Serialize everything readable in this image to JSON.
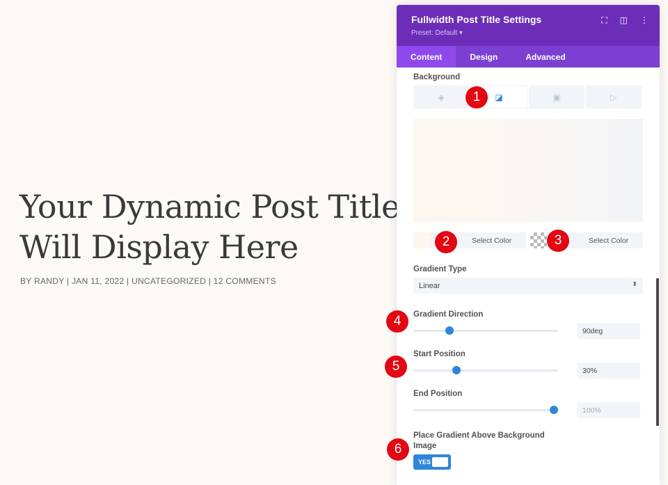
{
  "page": {
    "title": "Your Dynamic Post Title Will Display Here",
    "meta": "BY RANDY | JAN 11, 2022 | UNCATEGORIZED | 12 COMMENTS"
  },
  "panel": {
    "title": "Fullwidth Post Title Settings",
    "preset": "Preset: Default ▾",
    "tabs": [
      "Content",
      "Design",
      "Advanced"
    ],
    "background_label": "Background",
    "bg_tabs": [
      "color-icon",
      "gradient-icon",
      "image-icon",
      "video-icon"
    ],
    "color1": {
      "label": "Select Color",
      "swatch": "#fdf7f1"
    },
    "color2": {
      "label": "Select Color",
      "swatch": "transparent"
    },
    "gradient_type": {
      "label": "Gradient Type",
      "value": "Linear"
    },
    "gradient_direction": {
      "label": "Gradient Direction",
      "value": "90deg",
      "fraction": 0.25
    },
    "start_position": {
      "label": "Start Position",
      "value": "30%",
      "fraction": 0.3
    },
    "end_position": {
      "label": "End Position",
      "value": "100%",
      "fraction": 0.97
    },
    "place_above": {
      "label": "Place Gradient Above Background Image",
      "value": "YES"
    }
  },
  "badges": [
    "1",
    "2",
    "3",
    "4",
    "5",
    "6"
  ],
  "colors": {
    "header": "#6c2eb9",
    "accent": "#2e86d8",
    "badge": "#e30613"
  }
}
